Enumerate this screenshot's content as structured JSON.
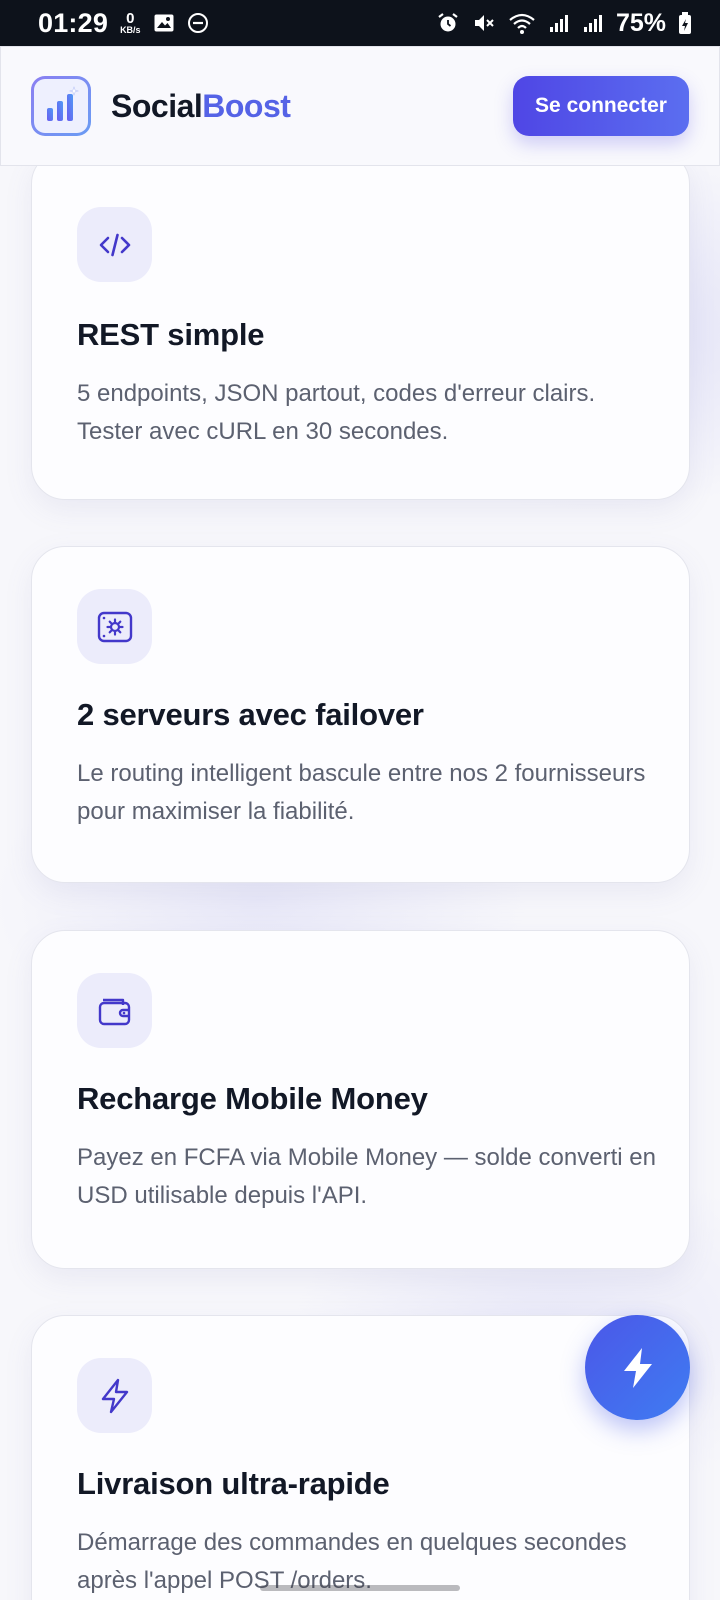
{
  "status_bar": {
    "time": "01:29",
    "net_speed_value": "0",
    "net_speed_unit": "KB/s",
    "battery": "75%"
  },
  "header": {
    "brand_part1": "Social",
    "brand_part2": "Boost",
    "login_label": "Se connecter"
  },
  "features": [
    {
      "icon": "code-icon",
      "title": "REST simple",
      "text": "5 endpoints, JSON partout, codes d'erreur clairs. Tester avec cURL en 30 secondes."
    },
    {
      "icon": "server-gear-icon",
      "title": "2 serveurs avec failover",
      "text": "Le routing intelligent bascule entre nos 2 fournisseurs pour maximiser la fiabilité."
    },
    {
      "icon": "wallet-icon",
      "title": "Recharge Mobile Money",
      "text": "Payez en FCFA via Mobile Money — solde converti en USD utilisable depuis l'API."
    },
    {
      "icon": "lightning-icon",
      "title": "Livraison ultra-rapide",
      "text": "Démarrage des commandes en quelques secondes après l'appel POST /orders."
    }
  ],
  "colors": {
    "accent": "#4f46e5",
    "brand_blue": "#5563e6",
    "icon_bg": "#ececfb",
    "icon_stroke": "#4338ca"
  }
}
